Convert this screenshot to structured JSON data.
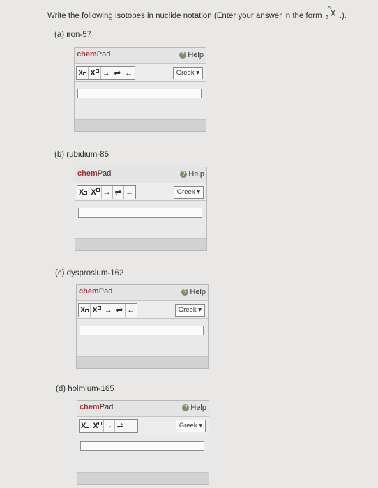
{
  "prompt": {
    "text": "Write the following isotopes in nuclide notation (Enter your answer in the form",
    "mass_symbol": "A",
    "atomic_symbol": "Z",
    "element_symbol": "X",
    "suffix": ".)."
  },
  "parts": [
    {
      "label": "(a)  iron-57"
    },
    {
      "label": "(b)  rubidium-85"
    },
    {
      "label": "(c)  dysprosium-162"
    },
    {
      "label": "(d)  holmium-165"
    }
  ],
  "chempad": {
    "title_chem": "chem",
    "title_pad": "Pad",
    "help_label": "Help",
    "help_icon": "question-circle-icon",
    "greek_label": "Greek",
    "tools": {
      "subscript": "X",
      "superscript": "X",
      "arrow": "→",
      "equilibrium": "⇌",
      "up_down": "⇅",
      "back_arrow": "←"
    }
  }
}
